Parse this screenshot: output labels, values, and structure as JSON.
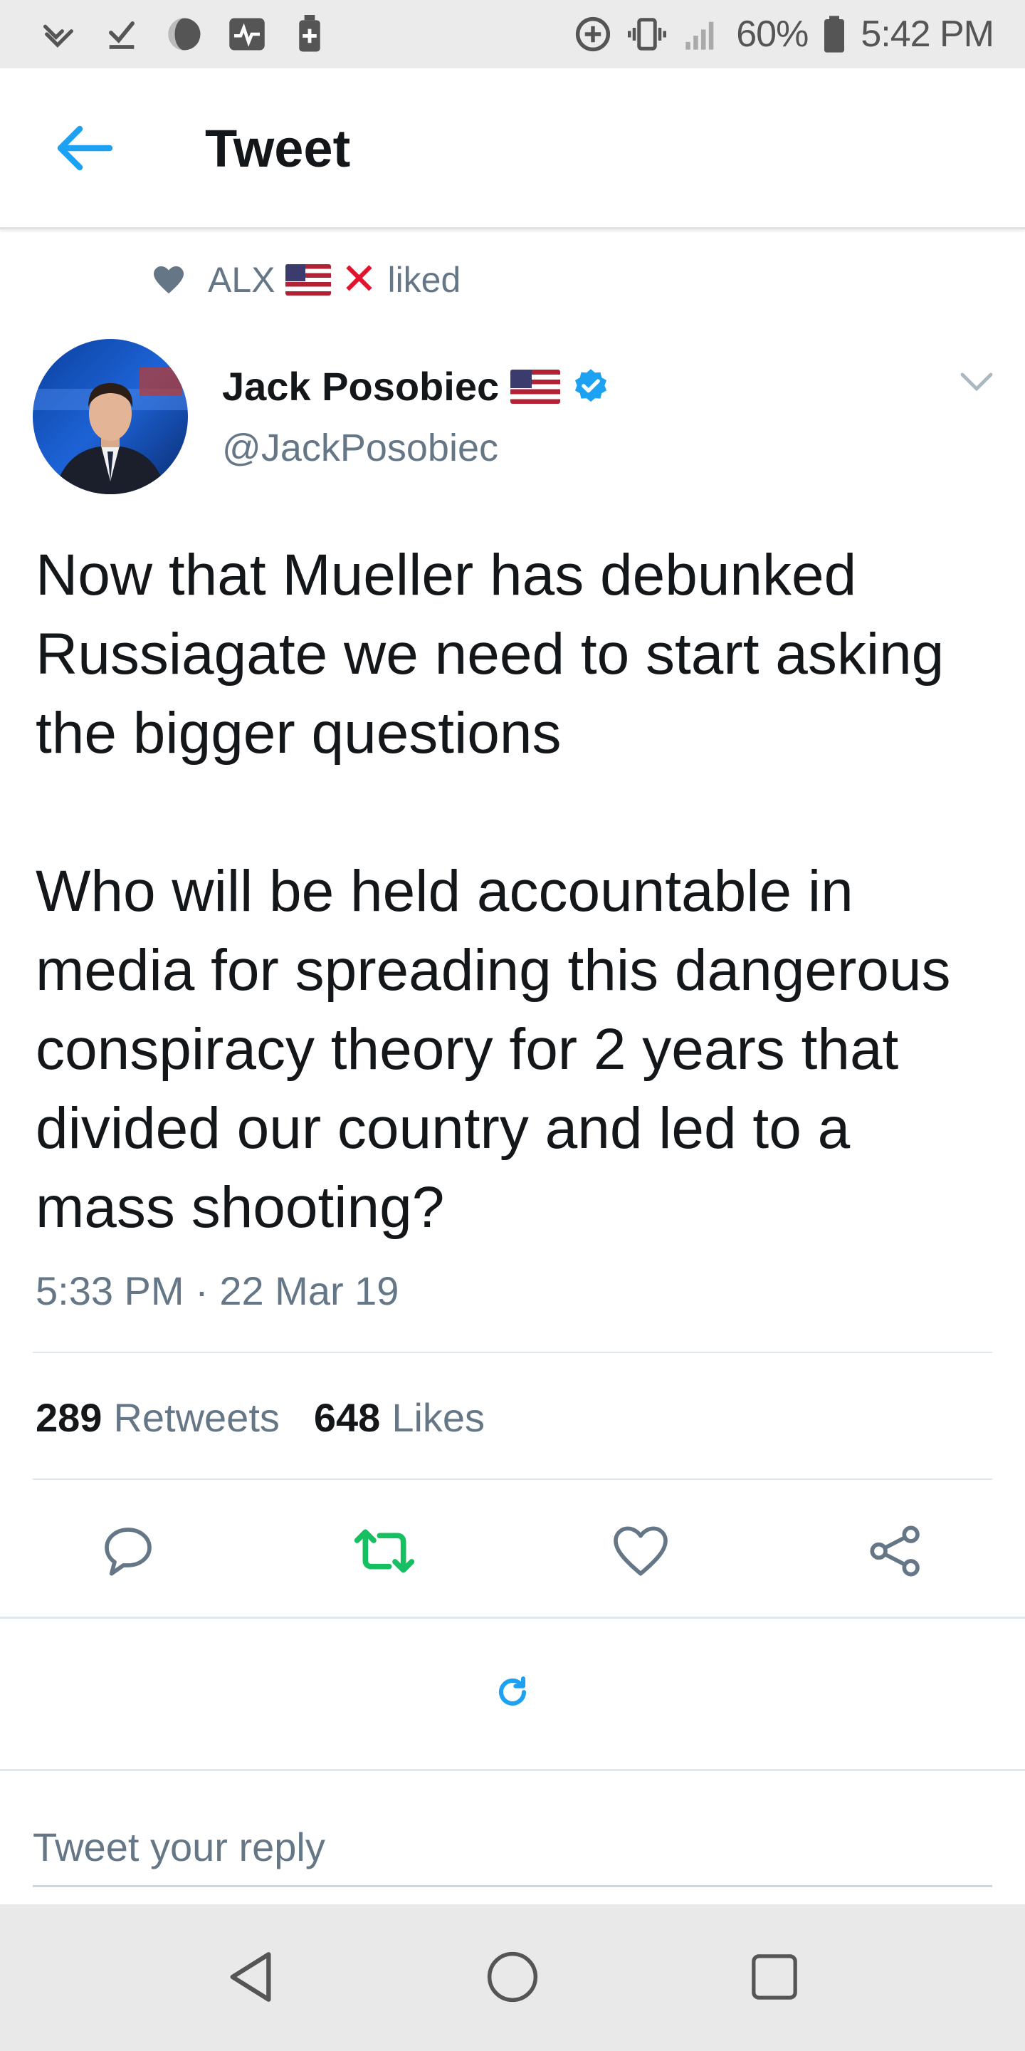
{
  "status_bar": {
    "battery_percent": "60%",
    "time": "5:42 PM",
    "left_icons": [
      "missed-call-icon",
      "download-done-icon",
      "do-not-disturb-icon",
      "activity-icon",
      "battery-plus-icon"
    ],
    "right_icons": [
      "data-saver-icon",
      "vibrate-icon",
      "signal-icon",
      "battery-icon"
    ]
  },
  "app_bar": {
    "title": "Tweet",
    "back_icon": "arrow-left-icon"
  },
  "liked_by": {
    "name": "ALX",
    "suffix": "liked",
    "icons": [
      "heart-icon",
      "us-flag-icon",
      "red-x-icon"
    ]
  },
  "tweet": {
    "author_name": "Jack Posobiec",
    "handle": "@JackPosobiec",
    "text": "Now that Mueller has debunked Russiagate we need to start asking the bigger questions\n\nWho will be held accountable in media for spreading this dangerous conspiracy theory for 2 years that divided our country and led to a mass shooting?",
    "timestamp": "5:33 PM · 22 Mar 19",
    "retweets_count": "289",
    "retweets_label": "Retweets",
    "likes_count": "648",
    "likes_label": "Likes"
  },
  "actions": [
    "reply-icon",
    "retweet-icon",
    "like-icon",
    "share-icon"
  ],
  "reply": {
    "placeholder": "Tweet your reply"
  },
  "nav_bar": [
    "back-triangle-icon",
    "home-circle-icon",
    "recents-square-icon"
  ],
  "colors": {
    "accent": "#1da1f2",
    "retweet_green": "#17bf63",
    "text_primary": "#14171a",
    "text_secondary": "#657786",
    "status_bar_bg": "#ebebeb",
    "nav_bar_bg": "#e9e9e9"
  }
}
